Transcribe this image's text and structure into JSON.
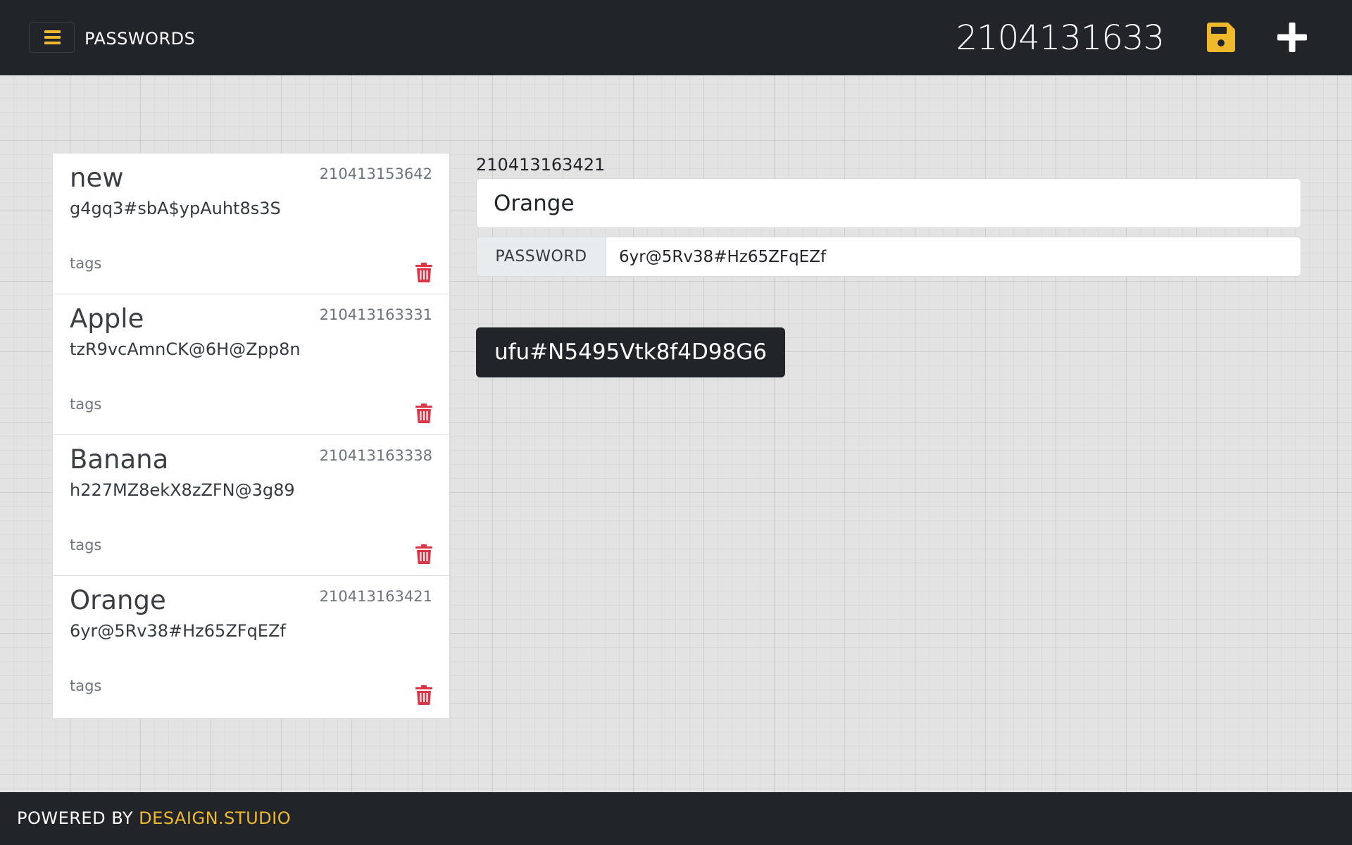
{
  "header": {
    "title": "PASSWORDS",
    "counter": "2104131633",
    "menu_icon": "hamburger-icon",
    "save_icon": "floppy-disk-icon",
    "add_icon": "plus-icon",
    "accent_color": "#f0b92c",
    "background_color": "#212529"
  },
  "list": {
    "items": [
      {
        "name": "new",
        "id": "210413153642",
        "password": "g4gq3#sbA$ypAuht8s3S",
        "tags": "tags",
        "delete_icon": "trash-icon"
      },
      {
        "name": "Apple",
        "id": "210413163331",
        "password": "tzR9vcAmnCK@6H@Zpp8n",
        "tags": "tags",
        "delete_icon": "trash-icon"
      },
      {
        "name": "Banana",
        "id": "210413163338",
        "password": "h227MZ8ekX8zZFN@3g89",
        "tags": "tags",
        "delete_icon": "trash-icon"
      },
      {
        "name": "Orange",
        "id": "210413163421",
        "password": "6yr@5Rv38#Hz65ZFqEZf",
        "tags": "tags",
        "delete_icon": "trash-icon"
      }
    ],
    "delete_color": "#dc3545"
  },
  "detail": {
    "id": "210413163421",
    "name_value": "Orange",
    "password_label": "PASSWORD",
    "password_value": "6yr@5Rv38#Hz65ZFqEZf",
    "generated_password": "ufu#N5495Vtk8f4D98G6"
  },
  "footer": {
    "prefix": "POWERED BY",
    "link": "DESAIGN.STUDIO"
  }
}
